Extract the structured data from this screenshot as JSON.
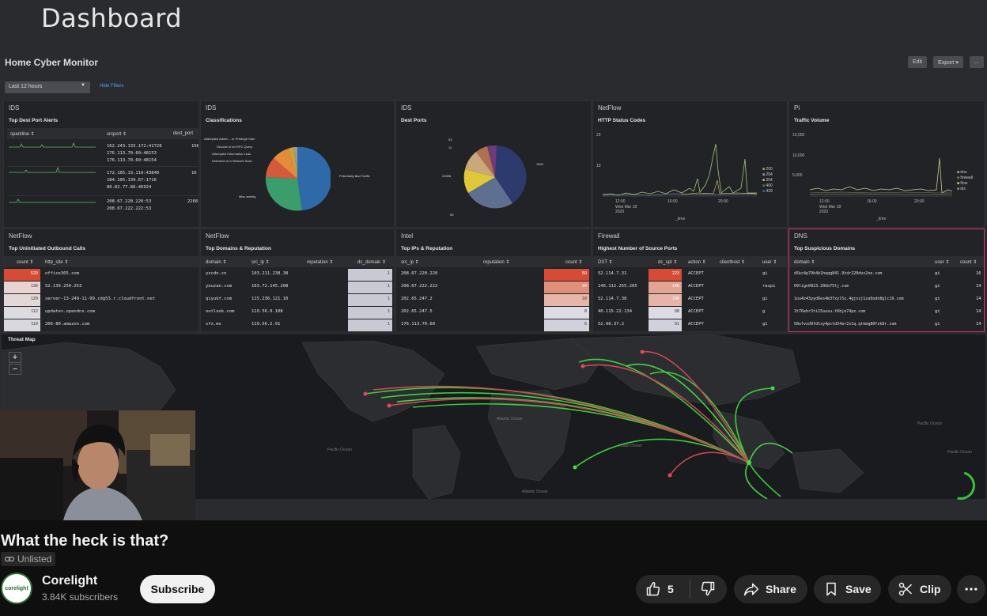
{
  "dashboard": {
    "title": "Dashboard",
    "app_title": "Home Cyber Monitor",
    "edit_label": "Edit",
    "export_label": "Export ▾",
    "more_label": "...",
    "time_range": "Last 12 hours",
    "hide_filters": "Hide Filters"
  },
  "panels": {
    "ids_alerts": {
      "source": "IDS",
      "title": "Top Dest Port Alerts",
      "headers": [
        "sparkline ⇕",
        "srcport ⇕",
        "dest_port"
      ],
      "groups": [
        {
          "ips": [
            "162.243.133.172:41728",
            "176.113.70.60:48153",
            "176.113.70.60:48154"
          ],
          "port": "198"
        },
        {
          "ips": [
            "172.105.13.119:43840",
            "184.105.139.67:1716",
            "80.82.77.86:46924"
          ],
          "port": "16"
        },
        {
          "ips": [
            "208.67.220.220:53",
            "208.67.222.222:53"
          ],
          "port": "2268"
        }
      ]
    },
    "ids_class": {
      "source": "IDS",
      "title": "Classifications",
      "labels": [
        "Attempted Admin... or Privilege Gain",
        "Decode of an RPC Query",
        "Attempted Information Leak",
        "Detection of a Network Scan",
        "Potentially Bad Traffic",
        "Misc activity"
      ]
    },
    "ids_ports": {
      "source": "IDS",
      "title": "Dest Ports",
      "labels": [
        "53",
        "11",
        "22606",
        "1500",
        "50"
      ]
    },
    "netflow_http": {
      "source": "NetFlow",
      "title": "HTTP Status Codes",
      "y_ticks": [
        "20",
        "10"
      ],
      "x_ticks": [
        "12:00",
        "16:00",
        "20:00"
      ],
      "x_date": "Wed Mar 18\n2020",
      "x_label": "_time",
      "legend": [
        "200",
        "204",
        "304",
        "400",
        "429"
      ],
      "legend_colors": [
        "#a3c47a",
        "#8fb3d9",
        "#d9cf7a",
        "#4f7f5a",
        "#3d6fbf"
      ]
    },
    "pi_traffic": {
      "source": "Pi",
      "title": "Traffic Volume",
      "y_ticks": [
        "15,000",
        "10,000",
        "5,000"
      ],
      "x_ticks": [
        "12:00",
        "16:00",
        "20:00"
      ],
      "x_date": "Wed Mar 18\n2020",
      "x_label": "_time",
      "legend": [
        "dns",
        "firewall",
        "flow",
        "ids"
      ],
      "legend_colors": [
        "#c9c98a",
        "#6f8f4f",
        "#d9d98f",
        "#9a9a9a"
      ]
    },
    "netflow_outbound": {
      "source": "NetFlow",
      "title": "Top Uninitiated Outbound Calls",
      "headers": [
        "count ⇕",
        "http_site ⇕"
      ],
      "rows": [
        {
          "count": "529",
          "site": "office365.com"
        },
        {
          "count": "136",
          "site": "52.139.250.253"
        },
        {
          "count": "129",
          "site": "server-13-249-11-99.cdg53.r.cloudfront.net"
        },
        {
          "count": "112",
          "site": "updates.opendns.com"
        },
        {
          "count": "110",
          "site": "206-80.amazon.com"
        }
      ]
    },
    "netflow_domains": {
      "source": "NetFlow",
      "title": "Top Domains & Reputation",
      "headers": [
        "domain ⇕",
        "src_ip ⇕",
        "reputation ⇕",
        "dc_domain ⇕"
      ],
      "rows": [
        {
          "domain": "yzcdn.cn",
          "ip": "103.211.238.38",
          "dc": "1"
        },
        {
          "domain": "youzan.com",
          "ip": "103.72.145.208",
          "dc": "1"
        },
        {
          "domain": "qiyukf.com",
          "ip": "115.236.121.10",
          "dc": "1"
        },
        {
          "domain": "outlook.com",
          "ip": "119.56.0.108",
          "dc": "1"
        },
        {
          "domain": "sfx.ms",
          "ip": "119.56.2.91",
          "dc": "1"
        }
      ]
    },
    "intel_ips": {
      "source": "Intel",
      "title": "Top IPs & Reputation",
      "headers": [
        "src_ip ⇕",
        "reputation ⇕",
        "count ⇕"
      ],
      "rows": [
        {
          "ip": "208.67.220.220",
          "count": "50"
        },
        {
          "ip": "208.67.222.222",
          "count": "24"
        },
        {
          "ip": "202.65.247.2",
          "count": "18"
        },
        {
          "ip": "202.65.247.5",
          "count": "8"
        },
        {
          "ip": "176.113.70.60",
          "count": "6"
        }
      ]
    },
    "firewall_ports": {
      "source": "Firewall",
      "title": "Highest Number of Source Ports",
      "headers": [
        "DST ⇕",
        "dc_spt ⇕",
        "action ⇕",
        "clienthost ⇕",
        "user ⇕"
      ],
      "rows": [
        {
          "dst": "52.114.7.31",
          "spt": "223",
          "action": "ACCEPT",
          "user": "gi"
        },
        {
          "dst": "146.112.255.205",
          "spt": "146",
          "action": "ACCEPT",
          "user": "raspi"
        },
        {
          "dst": "52.114.7.38",
          "spt": "136",
          "action": "ACCEPT",
          "user": "gi"
        },
        {
          "dst": "40.115.22.134",
          "spt": "98",
          "action": "ACCEPT",
          "user": "g"
        },
        {
          "dst": "52.98.37.2",
          "spt": "91",
          "action": "ACCEPT",
          "user": "gi"
        }
      ]
    },
    "dns_domains": {
      "source": "DNS",
      "title": "Top Suspicious Domains",
      "headers": [
        "domain ⇕",
        "user ⇕",
        "count ⇕"
      ],
      "rows": [
        {
          "domain": "d5kc4p79h4b1hopg841.9tdr220dvx2ne.com",
          "user": "gi",
          "count": "16"
        },
        {
          "domain": "09lign0823.20kb75lj.com",
          "user": "gi",
          "count": "14"
        },
        {
          "domain": "1ou4z43yyd6es4m37xyl5z.4gjszj1za9odn8glc19.com",
          "user": "gi",
          "count": "14"
        },
        {
          "domain": "3t76ebr3ti15ousu.t6bje74pz.com",
          "user": "gi",
          "count": "14"
        },
        {
          "domain": "58ofvzd9fdtzy4pctd34er2x1q.qtkmg80fzk8r.com",
          "user": "gi",
          "count": "14"
        }
      ]
    },
    "threat_map": {
      "title": "Threat Map",
      "zoom_in": "+",
      "zoom_out": "−",
      "oceans": [
        "Pacific Ocean",
        "Atlantic Ocean",
        "Indian Ocean",
        "Pacific Ocean",
        "Pacific Ocean",
        "Atlantic Ocean"
      ]
    }
  },
  "video": {
    "title": "What the heck is that?",
    "visibility": "Unlisted"
  },
  "channel": {
    "name": "Corelight",
    "subscribers": "3.84K subscribers",
    "avatar_text": "corelight",
    "subscribe_label": "Subscribe"
  },
  "actions": {
    "like_count": "5",
    "share_label": "Share",
    "save_label": "Save",
    "clip_label": "Clip"
  }
}
